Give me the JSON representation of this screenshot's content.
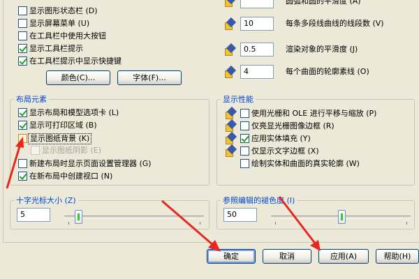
{
  "left_top": {
    "items": [
      {
        "label": "显示图形状态栏 (D)",
        "checked": false
      },
      {
        "label": "显示屏幕菜单 (U)",
        "checked": false
      },
      {
        "label": "在工具栏中使用大按钮",
        "checked": false
      },
      {
        "label": "显示工具栏提示",
        "checked": true
      },
      {
        "label": "在工具栏提示中显示快捷键",
        "checked": true
      }
    ],
    "colors_button": "颜色(C)...",
    "fonts_button": "字体(F)..."
  },
  "right_top": {
    "items": [
      {
        "value": "",
        "label": "圆弧和圆的平滑度 (A)"
      },
      {
        "value": "10",
        "label": "每条多段线曲线的线段数 (V)"
      },
      {
        "value": "0.5",
        "label": "渲染对象的平滑度 (J)"
      },
      {
        "value": "4",
        "label": "每个曲面的轮廓素线 (O)"
      }
    ]
  },
  "layout_elements": {
    "title": "布局元素",
    "items": [
      {
        "label": "显示布局和模型选项卡 (L)",
        "checked": true,
        "state": "normal"
      },
      {
        "label": "显示可打印区域 (B)",
        "checked": true,
        "state": "normal"
      },
      {
        "label": "显示图纸背景 (K)",
        "checked": false,
        "state": "highlight"
      },
      {
        "label": "显示图纸阴影 (E)",
        "checked": false,
        "state": "disabled"
      },
      {
        "label": "新建布局时显示页面设置管理器 (G)",
        "checked": false,
        "state": "normal"
      },
      {
        "label": "在新布局中创建视口 (N)",
        "checked": true,
        "state": "normal"
      }
    ]
  },
  "display_performance": {
    "title": "显示性能",
    "items": [
      {
        "label": "使用光栅和 OLE 进行平移与缩放 (P)",
        "checked": false
      },
      {
        "label": "仅亮显光栅图像边框 (R)",
        "checked": false
      },
      {
        "label": "应用实体填充 (Y)",
        "checked": true
      },
      {
        "label": "仅显示文字边框 (X)",
        "checked": false
      },
      {
        "label": "绘制实体和曲面的真实轮廓 (W)",
        "checked": false
      }
    ]
  },
  "crosshair": {
    "title": "十字光标大小 (Z)",
    "value": "5",
    "level_fraction": 0.05
  },
  "xref": {
    "title": "参照编辑的褪色度 (I)",
    "value": "50",
    "level_fraction": 0.5
  },
  "footer": {
    "ok": "确定",
    "cancel": "取消",
    "apply": "应用(A)",
    "help": "帮助(H)"
  },
  "colors": {
    "accent_red": "#e8271f",
    "group_title": "#0046d5"
  }
}
